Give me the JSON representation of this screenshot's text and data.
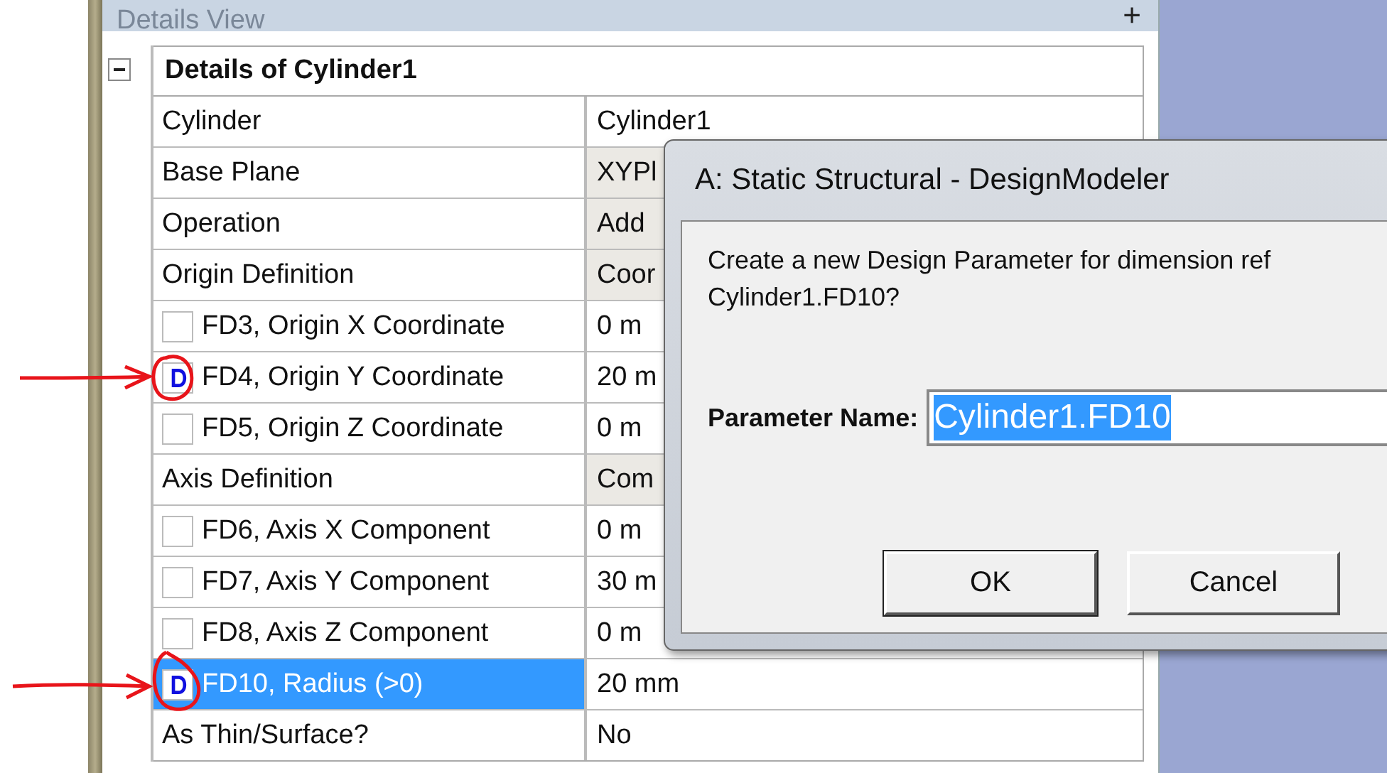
{
  "panel": {
    "title": "Details View",
    "pin": "+"
  },
  "details": {
    "heading": "Details of Cylinder1",
    "expanded": true,
    "rows": [
      {
        "kind": "plain",
        "label": "Cylinder",
        "value": "Cylinder1",
        "shaded": false,
        "selected": false
      },
      {
        "kind": "plain",
        "label": "Base Plane",
        "value": "XYPl",
        "shaded": true,
        "selected": false
      },
      {
        "kind": "plain",
        "label": "Operation",
        "value": "Add",
        "shaded": true,
        "selected": false
      },
      {
        "kind": "plain",
        "label": "Origin Definition",
        "value": "Coor",
        "shaded": true,
        "selected": false
      },
      {
        "kind": "param",
        "label": "FD3, Origin X Coordinate",
        "value": "0 m",
        "checked": false,
        "shaded": false,
        "selected": false
      },
      {
        "kind": "param",
        "label": "FD4, Origin Y Coordinate",
        "value": "20 m",
        "checked": true,
        "shaded": false,
        "selected": false
      },
      {
        "kind": "param",
        "label": "FD5, Origin Z Coordinate",
        "value": "0 m",
        "checked": false,
        "shaded": false,
        "selected": false
      },
      {
        "kind": "plain",
        "label": "Axis Definition",
        "value": "Com",
        "shaded": true,
        "selected": false
      },
      {
        "kind": "param",
        "label": "FD6, Axis X Component",
        "value": "0 m",
        "checked": false,
        "shaded": false,
        "selected": false
      },
      {
        "kind": "param",
        "label": "FD7, Axis Y Component",
        "value": "30 m",
        "checked": false,
        "shaded": false,
        "selected": false
      },
      {
        "kind": "param",
        "label": "FD8, Axis Z Component",
        "value": "0 m",
        "checked": false,
        "shaded": false,
        "selected": false
      },
      {
        "kind": "param",
        "label": "FD10, Radius (>0)",
        "value": "20 mm",
        "checked": true,
        "shaded": false,
        "selected": true
      },
      {
        "kind": "plain",
        "label": "As Thin/Surface?",
        "value": "No",
        "shaded": false,
        "selected": false
      }
    ]
  },
  "dialog": {
    "title": "A: Static Structural - DesignModeler",
    "message": [
      "Create a new Design Parameter for dimension ref",
      "Cylinder1.FD10?"
    ],
    "field_label": "Parameter Name:",
    "field_value": "Cylinder1.FD10",
    "buttons": [
      "OK",
      "Cancel"
    ]
  }
}
